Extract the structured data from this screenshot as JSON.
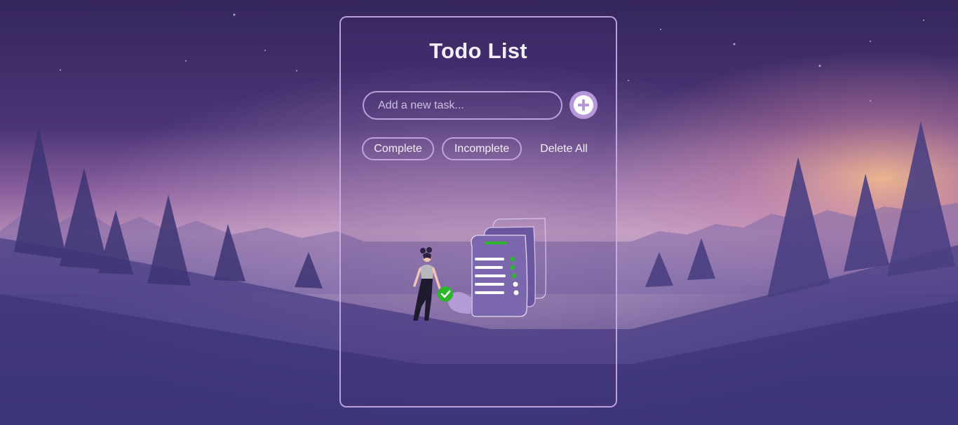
{
  "app": {
    "title": "Todo List"
  },
  "task_input": {
    "value": "",
    "placeholder": "Add a new task..."
  },
  "add_button": {
    "icon": "plus-icon"
  },
  "filters": {
    "complete_label": "Complete",
    "incomplete_label": "Incomplete",
    "delete_all_label": "Delete All"
  },
  "empty_state": {
    "illustration": "woman-with-checklist-illustration"
  },
  "colors": {
    "accent": "#b697d8",
    "check_green": "#2db52d",
    "text": "#f4eefc"
  }
}
